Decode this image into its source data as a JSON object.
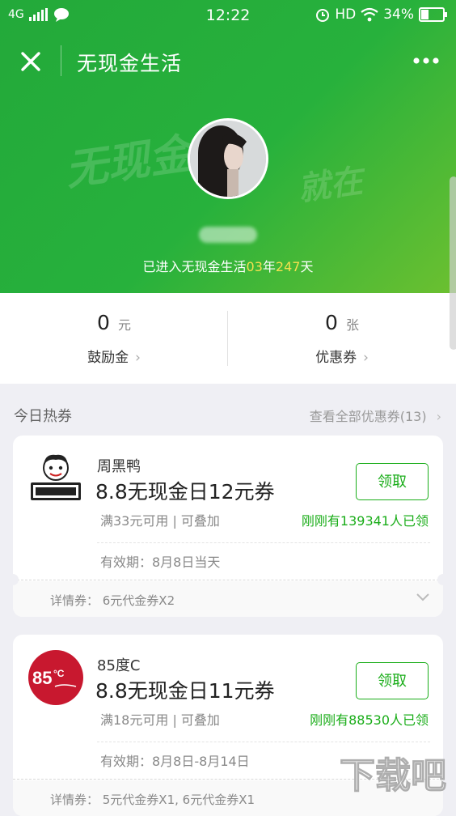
{
  "status_bar": {
    "network": "4G",
    "time": "12:22",
    "hd": "HD",
    "battery": "34%"
  },
  "nav": {
    "title": "无现金生活"
  },
  "profile": {
    "bg_text_left": "无现金",
    "bg_text_right": "就在"
  },
  "since": {
    "prefix": "已进入无现金生活",
    "years": "03",
    "year_unit": "年",
    "days": "247",
    "day_unit": "天"
  },
  "stats": {
    "bonus": {
      "value": "0",
      "unit": "元",
      "label": "鼓励金"
    },
    "coupons": {
      "value": "0",
      "unit": "张",
      "label": "优惠券"
    }
  },
  "section": {
    "title": "今日热券",
    "view_all": "查看全部优惠券(13)"
  },
  "coupons": [
    {
      "brand": "周黑鸭",
      "title": "8.8无现金日12元券",
      "conditions": "满33元可用 | 可叠加",
      "button": "领取",
      "claimed": "刚刚有139341人已领",
      "validity": "有效期：8月8日当天",
      "detail": "详情券：  6元代金券X2",
      "logo_text": "周黑鸭"
    },
    {
      "brand": "85度C",
      "title": "8.8无现金日11元券",
      "conditions": "满18元可用 | 可叠加",
      "button": "领取",
      "claimed": "刚刚有88530人已领",
      "validity": "有效期：8月8日-8月14日",
      "detail": "详情券：  5元代金券X1, 6元代金券X1",
      "logo_text": "85°C",
      "logo_sub": "Daily Cafe"
    }
  ],
  "watermark": "下载吧"
}
